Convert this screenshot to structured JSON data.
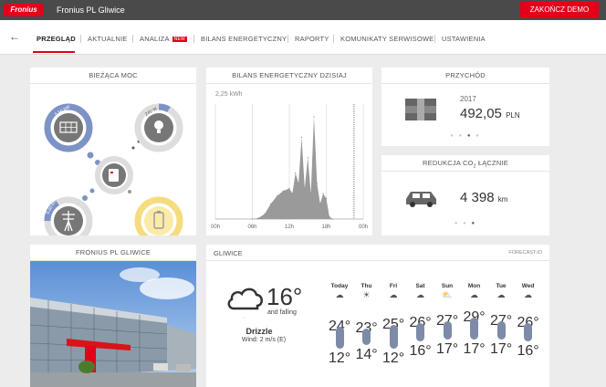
{
  "topbar": {
    "logo_text": "Fronius",
    "site_name": "Fronius PL Gliwice",
    "end_demo": "ZAKOŃCZ DEMO"
  },
  "nav": {
    "back_glyph": "←",
    "items": [
      "PRZEGLĄD",
      "AKTUALNIE",
      "ANALIZA",
      "BILANS ENERGETYCZNY",
      "RAPORTY",
      "KOMUNIKATY SERWISOWE",
      "USTAWIENIA"
    ],
    "new_badge": "NEW"
  },
  "current_power": {
    "title": "BIEŻĄCA MOC",
    "pv_label": "5.56 kW",
    "load_label": "245 W",
    "grid_label": "5.00 kW",
    "battery_pct": 0.6
  },
  "energy_balance": {
    "title": "BILANS ENERGETYCZNY DZISIAJ",
    "ylabel": "2,25 kWh",
    "chart_data": {
      "type": "area",
      "x_ticks": [
        "00h",
        "06h",
        "12h",
        "18h",
        "00h"
      ],
      "x": [
        6,
        7,
        8,
        9,
        10,
        11,
        12,
        12.5,
        13,
        13.5,
        14,
        14.5,
        15,
        15.5,
        16,
        16.5,
        17,
        17.5,
        18,
        18.5,
        19
      ],
      "values": [
        0,
        0.02,
        0.1,
        0.3,
        0.45,
        0.55,
        0.6,
        0.5,
        0.9,
        0.7,
        1.6,
        0.6,
        1.2,
        0.5,
        2.0,
        0.7,
        0.3,
        0.5,
        0.4,
        0.05,
        0
      ],
      "ylim": [
        0,
        2.25
      ],
      "xlim": [
        0,
        24
      ]
    }
  },
  "revenue": {
    "title": "PRZYCHÓD",
    "year": "2017",
    "amount": "492,05",
    "currency": "PLN"
  },
  "co2": {
    "title_main": "REDUKCJA CO",
    "title_sub": "2",
    "title_end": " ŁĄCZNIE",
    "value": "4 398",
    "unit": "km"
  },
  "photo_card": {
    "title": "FRONIUS PL GLIWICE"
  },
  "weather": {
    "title": "GLIWICE",
    "source": "FORECAST.IO",
    "temp": "16°",
    "trend": "and falling",
    "condition": "Drizzle",
    "wind": "Wind: 2 m/s (E)",
    "days": [
      {
        "name": "Today",
        "icon": "cloud-icon",
        "hi": "24°",
        "lo": "12°",
        "hi_v": 24,
        "lo_v": 12
      },
      {
        "name": "Thu",
        "icon": "sun-icon",
        "hi": "23°",
        "lo": "14°",
        "hi_v": 23,
        "lo_v": 14
      },
      {
        "name": "Fri",
        "icon": "cloud-icon",
        "hi": "25°",
        "lo": "12°",
        "hi_v": 25,
        "lo_v": 12
      },
      {
        "name": "Sat",
        "icon": "cloud-icon",
        "hi": "26°",
        "lo": "16°",
        "hi_v": 26,
        "lo_v": 16
      },
      {
        "name": "Sun",
        "icon": "partly-cloudy-icon",
        "hi": "27°",
        "lo": "17°",
        "hi_v": 27,
        "lo_v": 17
      },
      {
        "name": "Mon",
        "icon": "cloud-icon",
        "hi": "29°",
        "lo": "17°",
        "hi_v": 29,
        "lo_v": 17
      },
      {
        "name": "Tue",
        "icon": "cloud-icon",
        "hi": "27°",
        "lo": "17°",
        "hi_v": 27,
        "lo_v": 17
      },
      {
        "name": "Wed",
        "icon": "cloud-icon",
        "hi": "26°",
        "lo": "16°",
        "hi_v": 26,
        "lo_v": 16
      }
    ]
  },
  "colors": {
    "accent": "#e2001a",
    "pv_ring": "#7d93c6",
    "battery_ring": "#f5dc7e",
    "bar": "#7d8ba8"
  }
}
